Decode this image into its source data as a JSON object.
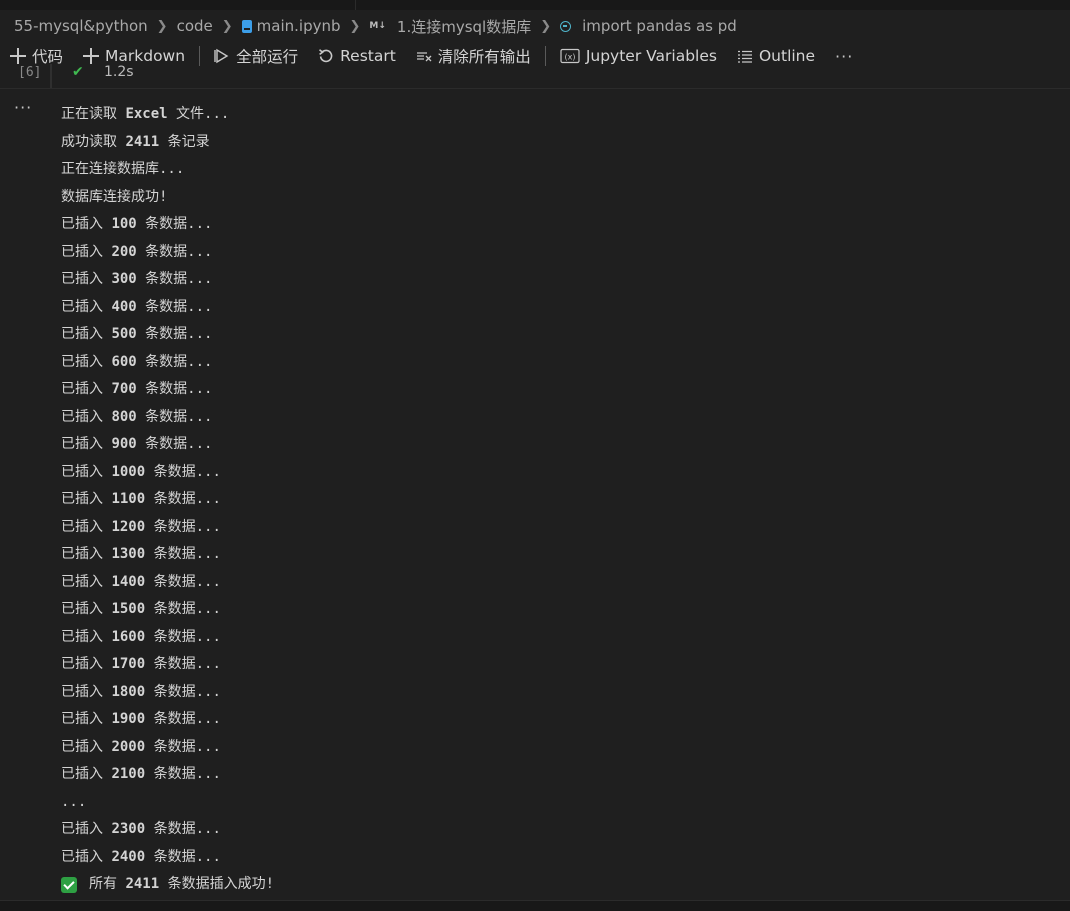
{
  "breadcrumb": {
    "items": [
      "55-mysql&python",
      "code",
      "main.ipynb",
      "1.连接mysql数据库",
      "import pandas as pd"
    ],
    "md_icon_label": "M↓"
  },
  "toolbar": {
    "code_label": "代码",
    "markdown_label": "Markdown",
    "run_all_label": "全部运行",
    "restart_label": "Restart",
    "clear_outputs_label": "清除所有输出",
    "variables_label": "Jupyter Variables",
    "variables_icon_label": "(x)",
    "outline_label": "Outline",
    "more_label": "···"
  },
  "cell": {
    "execution_count": "[6]",
    "duration": "1.2s",
    "output_menu": "···"
  },
  "output": {
    "intro": [
      {
        "pre": "正在读取 ",
        "num": "Excel",
        "post": " 文件..."
      },
      {
        "pre": "成功读取 ",
        "num": "2411",
        "post": " 条记录"
      },
      {
        "pre": "正在连接数据库...",
        "num": "",
        "post": ""
      },
      {
        "pre": "数据库连接成功!",
        "num": "",
        "post": ""
      }
    ],
    "progress_prefix": "已插入 ",
    "progress_suffix": " 条数据...",
    "progress_counts": [
      "100",
      "200",
      "300",
      "400",
      "500",
      "600",
      "700",
      "800",
      "900",
      "1000",
      "1100",
      "1200",
      "1300",
      "1400",
      "1500",
      "1600",
      "1700",
      "1800",
      "1900",
      "2000",
      "2100"
    ],
    "ellipsis": "...",
    "tail_counts": [
      "2300",
      "2400"
    ],
    "done": {
      "pre": "所有 ",
      "num": "2411",
      "post": " 条数据插入成功!"
    }
  },
  "colors": {
    "background": "#1f1f1f",
    "success": "#2ea043",
    "notebook_icon": "#3c9ee8",
    "python_icon": "#4fb3c8"
  }
}
